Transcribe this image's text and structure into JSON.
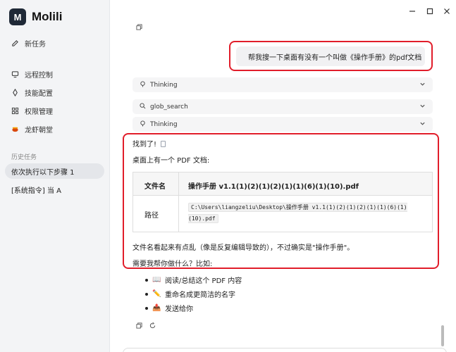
{
  "app": {
    "name": "Molili",
    "logo_text": "M"
  },
  "nav": [
    {
      "label": "新任务",
      "icon": "edit-icon"
    },
    {
      "label": "远程控制",
      "icon": "remote-icon"
    },
    {
      "label": "技能配置",
      "icon": "skill-icon"
    },
    {
      "label": "权限管理",
      "icon": "grid-icon"
    },
    {
      "label": "龙虾朝堂",
      "icon": "crab-icon"
    }
  ],
  "history": {
    "label": "历史任务",
    "items": [
      {
        "label": "依次执行以下步骤 1",
        "active": true
      },
      {
        "label": "[系统指令] 当 A",
        "active": false
      }
    ]
  },
  "chat": {
    "user_message": "帮我搜一下桌面有没有一个叫做《操作手册》的pdf文档",
    "steps": [
      {
        "label": "Thinking",
        "icon": "lightbulb-icon"
      },
      {
        "label": "glob_search",
        "icon": "search-icon"
      },
      {
        "label": "Thinking",
        "icon": "lightbulb-icon"
      }
    ],
    "found": "找到了!",
    "desc": "桌面上有一个 PDF 文档:",
    "table": {
      "col1_header": "文件名",
      "col2_header": "操作手册 v1.1(1)(2)(1)(2)(1)(1)(6)(1)(10).pdf",
      "row_label": "路径",
      "path": "C:\\Users\\liangzeliu\\Desktop\\操作手册 v1.1(1)(2)(1)(2)(1)(1)(6)(1)(10).pdf"
    },
    "note": "文件名看起来有点乱（像是反复编辑导致的），不过确实是\"操作手册\"。",
    "question": "需要我帮你做什么？比如:",
    "options": [
      {
        "emoji": "📖",
        "label": "阅读/总结这个 PDF 内容"
      },
      {
        "emoji": "✏️",
        "label": "重命名成更简洁的名字"
      },
      {
        "emoji": "📤",
        "label": "发送给你"
      }
    ]
  },
  "colors": {
    "highlight": "#e11d2a",
    "sidebar_bg": "#f3f4f6"
  }
}
